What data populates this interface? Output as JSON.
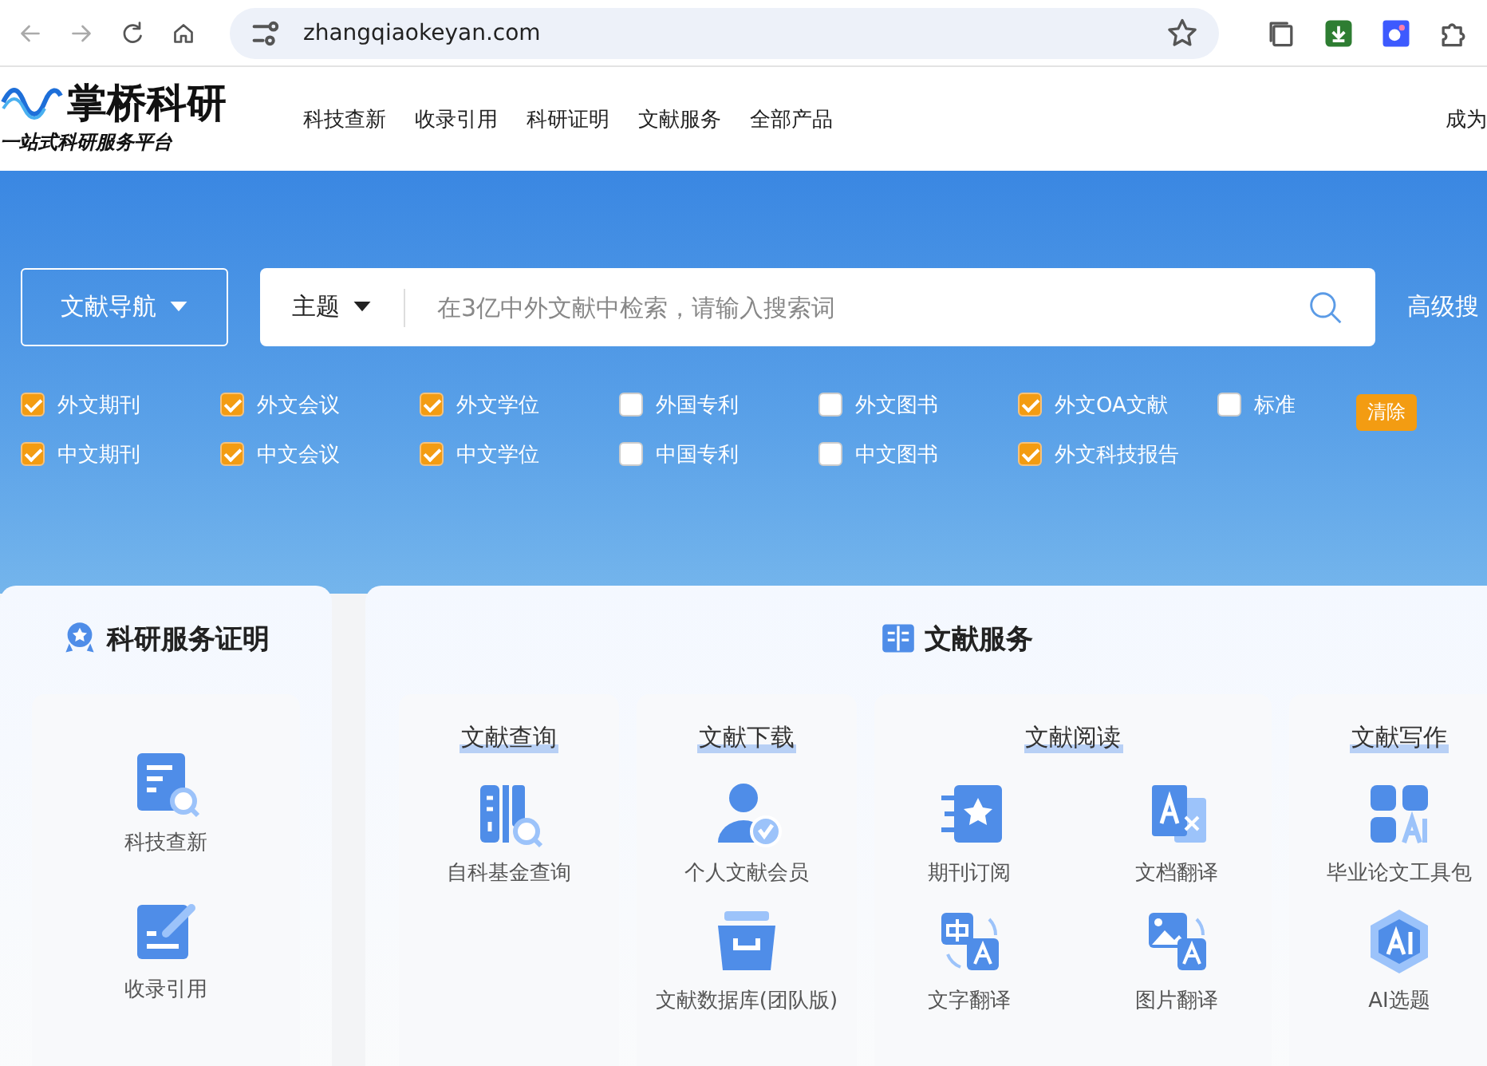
{
  "browser": {
    "url": "zhangqiaokeyan.com"
  },
  "header": {
    "logo": "掌桥科研",
    "tagline": "一站式科研服务平台",
    "nav": [
      "科技查新",
      "收录引用",
      "科研证明",
      "文献服务",
      "全部产品"
    ],
    "right_link": "成为"
  },
  "search": {
    "nav_button": "文献导航",
    "scope": "主题",
    "placeholder": "在3亿中外文献中检索，请输入搜索词",
    "advanced": "高级搜"
  },
  "filters": {
    "rows": [
      [
        {
          "label": "外文期刊",
          "checked": true
        },
        {
          "label": "外文会议",
          "checked": true
        },
        {
          "label": "外文学位",
          "checked": true
        },
        {
          "label": "外国专利",
          "checked": false
        },
        {
          "label": "外文图书",
          "checked": false
        },
        {
          "label": "外文OA文献",
          "checked": true
        },
        {
          "label": "标准",
          "checked": false
        }
      ],
      [
        {
          "label": "中文期刊",
          "checked": true
        },
        {
          "label": "中文会议",
          "checked": true
        },
        {
          "label": "中文学位",
          "checked": true
        },
        {
          "label": "中国专利",
          "checked": false
        },
        {
          "label": "中文图书",
          "checked": false
        },
        {
          "label": "外文科技报告",
          "checked": true
        }
      ]
    ],
    "clear_button": "清除"
  },
  "proof_card": {
    "title": "科研服务证明",
    "items": [
      "科技查新",
      "收录引用"
    ]
  },
  "literature_card": {
    "title": "文献服务",
    "columns": [
      {
        "title": "文献查询",
        "items": [
          "自科基金查询"
        ]
      },
      {
        "title": "文献下载",
        "items": [
          "个人文献会员",
          "文献数据库(团队版)"
        ]
      },
      {
        "title": "文献阅读",
        "items": [
          "期刊订阅",
          "文档翻译",
          "文字翻译",
          "图片翻译"
        ]
      },
      {
        "title": "文献写作",
        "items": [
          "毕业论文工具包",
          "AI选题"
        ]
      }
    ]
  }
}
